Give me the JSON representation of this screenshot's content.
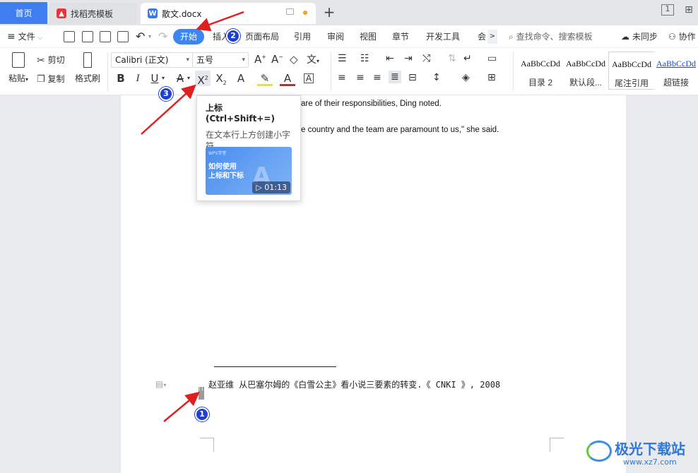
{
  "tabs": {
    "home": "首页",
    "template": "找稻壳模板",
    "document": "散文.docx"
  },
  "menu": {
    "file": "文件",
    "items": [
      "开始",
      "插入",
      "页面布局",
      "引用",
      "审阅",
      "视图",
      "章节",
      "开发工具",
      "会"
    ],
    "search_placeholder": "查找命令、搜索模板",
    "sync": "未同步",
    "collab": "协作"
  },
  "ribbon": {
    "paste": "粘贴",
    "cut": "剪切",
    "copy": "复制",
    "format_painter": "格式刷",
    "font_name": "Calibri (正文)",
    "font_size": "五号",
    "styles": [
      {
        "sample": "AaBbCcDd",
        "name": "目录 2"
      },
      {
        "sample": "AaBbCcDd",
        "name": "默认段..."
      },
      {
        "sample": "AaBbCcDd",
        "name": "尾注引用"
      },
      {
        "sample": "AaBbCcDd",
        "name": "超链接"
      }
    ]
  },
  "tooltip": {
    "title": "上标 (Ctrl+Shift+=)",
    "description": "在文本行上方创建小字符。",
    "video_brand": "WPS学堂",
    "video_caption_1": "如何使用",
    "video_caption_2": "上标和下标",
    "video_duration": "01:13"
  },
  "document": {
    "line1": "are of their responsibilities, Ding noted.",
    "line2": "e country and the team are paramount to us,\" she said.",
    "footnote_mark": "[1]",
    "footnote_text": "赵亚维  从巴塞尔姆的《白雪公主》看小说三要素的转变.《 CNKI 》, 2008"
  },
  "annotations": [
    "1",
    "2",
    "3"
  ],
  "watermark": {
    "title": "极光下载站",
    "url": "www.xz7.com"
  },
  "colors": {
    "accent": "#3b86f2",
    "arrow": "#e02020",
    "badge": "#1f3fd1"
  }
}
